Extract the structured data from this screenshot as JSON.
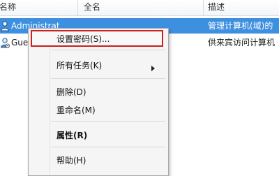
{
  "columns": {
    "name": "名称",
    "full_name": "全名",
    "description": "描述"
  },
  "rows": [
    {
      "name": "Administrat",
      "full_name": "",
      "description": "管理计算机(域)的",
      "selected": true,
      "icon": "user-icon"
    },
    {
      "name": "Gue",
      "full_name": "",
      "description": "供来宾访问计算机",
      "selected": false,
      "icon": "user-icon"
    }
  ],
  "context_menu": {
    "items": [
      {
        "label": "设置密码(S)...",
        "highlighted": true
      },
      {
        "label": "所有任务(K)",
        "has_submenu": true
      },
      {
        "label": "删除(D)"
      },
      {
        "label": "重命名(M)"
      },
      {
        "label": "属性(R)",
        "bold": true
      },
      {
        "label": "帮助(H)"
      }
    ],
    "highlight_color": "#cc1f1f"
  },
  "colors": {
    "selection": "#3d8fe0"
  }
}
